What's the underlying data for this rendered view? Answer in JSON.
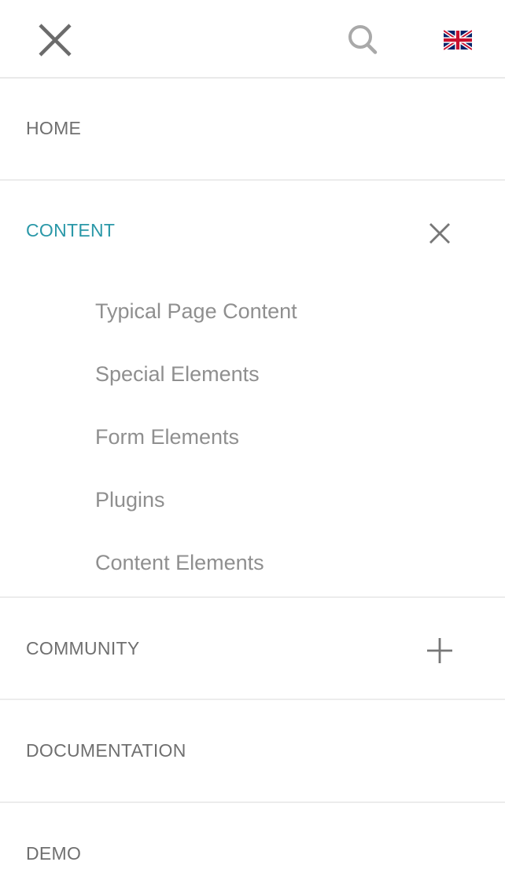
{
  "header": {
    "close_icon": "close-icon",
    "search_icon": "search-icon",
    "language_icon": "uk-flag-icon"
  },
  "menu": {
    "home": {
      "label": "HOME"
    },
    "content": {
      "label": "CONTENT",
      "toggle_icon": "close-icon",
      "active_color": "#2a98a8",
      "children": [
        {
          "label": "Typical Page Content"
        },
        {
          "label": "Special Elements"
        },
        {
          "label": "Form Elements"
        },
        {
          "label": "Plugins"
        },
        {
          "label": "Content Elements"
        }
      ]
    },
    "community": {
      "label": "COMMUNITY",
      "toggle_icon": "plus-icon"
    },
    "documentation": {
      "label": "DOCUMENTATION"
    },
    "demo": {
      "label": "DEMO"
    }
  }
}
